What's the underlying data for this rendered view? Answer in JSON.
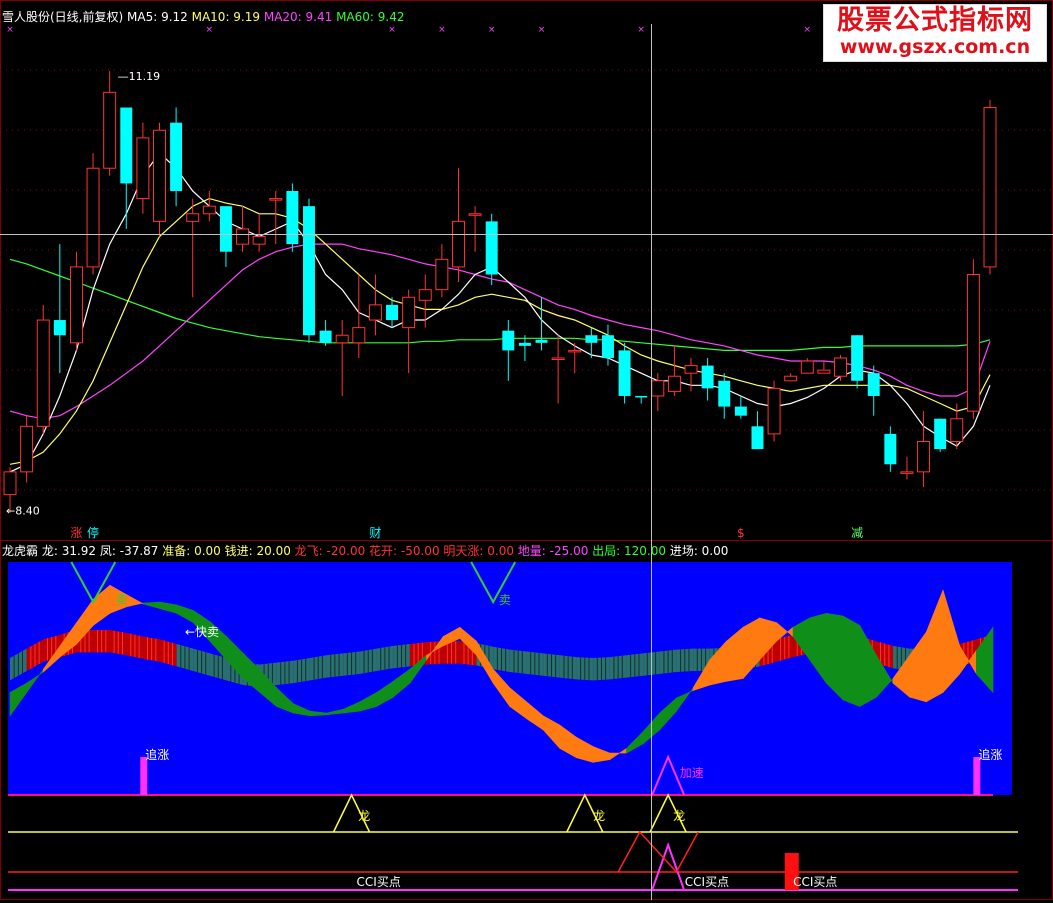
{
  "header": {
    "stock": "雪人股份(日线,前复权)",
    "ma": [
      {
        "label": "MA5: 9.12",
        "color": "#ffffff"
      },
      {
        "label": "MA10: 9.19",
        "color": "#ffff66"
      },
      {
        "label": "MA20: 9.41",
        "color": "#ff44ff"
      },
      {
        "label": "MA60: 9.42",
        "color": "#33ff33"
      }
    ]
  },
  "logo": {
    "name": "股票公式指标网",
    "url": "www.gszx.com.cn"
  },
  "colors": {
    "up": "#ff3333",
    "down": "#00ffff",
    "ma5": "#ffffff",
    "ma10": "#ffff66",
    "ma20": "#ff44ff",
    "ma60": "#33ff33",
    "panel_bg": "#0000ff",
    "orange": "#ff7a10",
    "green": "#0f8f1a",
    "crosshair": "#c0c0c0"
  },
  "chart_data": [
    {
      "type": "candlestick",
      "ylim": [
        8.2,
        11.5
      ],
      "high_label": "11.19",
      "low_label": "8.40",
      "candles": [
        [
          8.4,
          8.55,
          8.28,
          8.58
        ],
        [
          8.55,
          8.85,
          8.48,
          8.92
        ],
        [
          8.85,
          9.55,
          8.8,
          9.65
        ],
        [
          9.55,
          9.45,
          9.2,
          10.05
        ],
        [
          9.4,
          9.9,
          9.35,
          10.0
        ],
        [
          9.9,
          10.55,
          9.85,
          10.65
        ],
        [
          10.55,
          11.05,
          10.5,
          11.19
        ],
        [
          10.95,
          10.45,
          10.15,
          10.95
        ],
        [
          10.35,
          10.75,
          10.25,
          10.85
        ],
        [
          10.2,
          10.8,
          10.1,
          10.85
        ],
        [
          10.85,
          10.4,
          10.3,
          10.95
        ],
        [
          10.2,
          10.25,
          9.7,
          10.35
        ],
        [
          10.25,
          10.3,
          10.2,
          10.4
        ],
        [
          10.3,
          10.0,
          9.9,
          10.3
        ],
        [
          10.05,
          10.15,
          10.0,
          10.3
        ],
        [
          10.05,
          10.1,
          10.0,
          10.25
        ],
        [
          10.35,
          10.35,
          10.05,
          10.4
        ],
        [
          10.4,
          10.05,
          10.0,
          10.45
        ],
        [
          10.3,
          9.45,
          9.4,
          10.35
        ],
        [
          9.48,
          9.4,
          9.38,
          9.55
        ],
        [
          9.4,
          9.45,
          9.05,
          9.55
        ],
        [
          9.4,
          9.5,
          9.3,
          9.85
        ],
        [
          9.55,
          9.65,
          9.45,
          9.85
        ],
        [
          9.65,
          9.55,
          9.5,
          9.7
        ],
        [
          9.5,
          9.7,
          9.2,
          9.75
        ],
        [
          9.68,
          9.75,
          9.5,
          9.85
        ],
        [
          9.75,
          9.95,
          9.7,
          10.05
        ],
        [
          9.9,
          10.2,
          9.8,
          10.55
        ],
        [
          10.25,
          10.25,
          10.0,
          10.3
        ],
        [
          10.2,
          9.85,
          9.78,
          10.25
        ],
        [
          9.48,
          9.35,
          9.15,
          9.55
        ],
        [
          9.4,
          9.38,
          9.28,
          9.45
        ],
        [
          9.42,
          9.4,
          9.35,
          9.7
        ],
        [
          9.3,
          9.3,
          9.0,
          9.45
        ],
        [
          9.35,
          9.35,
          9.2,
          9.4
        ],
        [
          9.45,
          9.4,
          9.3,
          9.5
        ],
        [
          9.45,
          9.3,
          9.25,
          9.52
        ],
        [
          9.35,
          9.05,
          9.0,
          9.4
        ],
        [
          9.05,
          9.04,
          9.0,
          9.05
        ],
        [
          9.05,
          9.15,
          8.95,
          9.2
        ],
        [
          9.08,
          9.18,
          9.05,
          9.38
        ],
        [
          9.2,
          9.25,
          9.08,
          9.3
        ],
        [
          9.25,
          9.1,
          9.02,
          9.3
        ],
        [
          9.15,
          8.98,
          8.9,
          9.2
        ],
        [
          8.98,
          8.92,
          8.9,
          9.05
        ],
        [
          8.85,
          8.7,
          8.7,
          8.95
        ],
        [
          8.8,
          9.1,
          8.75,
          9.15
        ],
        [
          9.15,
          9.18,
          9.15,
          9.2
        ],
        [
          9.2,
          9.28,
          9.2,
          9.3
        ],
        [
          9.2,
          9.22,
          9.2,
          9.28
        ],
        [
          9.18,
          9.3,
          9.15,
          9.32
        ],
        [
          9.45,
          9.15,
          9.1,
          9.45
        ],
        [
          9.2,
          9.05,
          8.92,
          9.25
        ],
        [
          8.8,
          8.6,
          8.55,
          8.85
        ],
        [
          8.55,
          8.55,
          8.5,
          8.65
        ],
        [
          8.55,
          8.75,
          8.45,
          8.95
        ],
        [
          8.9,
          8.7,
          8.68,
          8.9
        ],
        [
          8.75,
          8.9,
          8.7,
          9.0
        ],
        [
          8.95,
          9.85,
          8.9,
          9.95
        ],
        [
          9.9,
          10.95,
          9.85,
          11.0
        ]
      ],
      "ma5": [
        8.55,
        8.6,
        8.8,
        9.05,
        9.35,
        9.75,
        10.05,
        10.25,
        10.5,
        10.65,
        10.55,
        10.4,
        10.3,
        10.2,
        10.15,
        10.1,
        10.15,
        10.2,
        10.05,
        9.85,
        9.75,
        9.6,
        9.55,
        9.5,
        9.55,
        9.55,
        9.62,
        9.72,
        9.85,
        9.9,
        9.8,
        9.7,
        9.55,
        9.45,
        9.38,
        9.32,
        9.3,
        9.25,
        9.2,
        9.15,
        9.15,
        9.12,
        9.12,
        9.1,
        9.05,
        9.0,
        8.98,
        9.0,
        9.04,
        9.1,
        9.18,
        9.22,
        9.2,
        9.12,
        9.0,
        8.85,
        8.78,
        8.72,
        8.85,
        9.12
      ],
      "ma10": [
        8.6,
        8.62,
        8.68,
        8.8,
        8.95,
        9.15,
        9.4,
        9.65,
        9.9,
        10.1,
        10.2,
        10.3,
        10.35,
        10.32,
        10.3,
        10.25,
        10.25,
        10.22,
        10.15,
        10.05,
        9.95,
        9.85,
        9.75,
        9.68,
        9.65,
        9.62,
        9.62,
        9.65,
        9.7,
        9.72,
        9.7,
        9.68,
        9.62,
        9.58,
        9.55,
        9.5,
        9.45,
        9.38,
        9.32,
        9.28,
        9.25,
        9.22,
        9.2,
        9.18,
        9.15,
        9.12,
        9.1,
        9.08,
        9.1,
        9.12,
        9.12,
        9.12,
        9.12,
        9.12,
        9.1,
        9.05,
        9.0,
        8.95,
        8.98,
        9.19
      ],
      "ma20": [
        8.95,
        8.92,
        8.9,
        8.92,
        8.98,
        9.05,
        9.12,
        9.2,
        9.28,
        9.38,
        9.48,
        9.58,
        9.68,
        9.78,
        9.88,
        9.95,
        10.0,
        10.03,
        10.05,
        10.05,
        10.05,
        10.02,
        10.0,
        9.98,
        9.95,
        9.92,
        9.9,
        9.88,
        9.85,
        9.82,
        9.8,
        9.75,
        9.7,
        9.65,
        9.62,
        9.58,
        9.55,
        9.52,
        9.5,
        9.48,
        9.45,
        9.42,
        9.4,
        9.38,
        9.35,
        9.32,
        9.3,
        9.28,
        9.28,
        9.28,
        9.27,
        9.25,
        9.22,
        9.18,
        9.12,
        9.08,
        9.05,
        9.05,
        9.1,
        9.41
      ],
      "ma60": [
        9.95,
        9.92,
        9.88,
        9.84,
        9.8,
        9.76,
        9.72,
        9.68,
        9.64,
        9.6,
        9.56,
        9.53,
        9.5,
        9.48,
        9.46,
        9.44,
        9.43,
        9.42,
        9.41,
        9.4,
        9.4,
        9.4,
        9.4,
        9.4,
        9.4,
        9.41,
        9.41,
        9.42,
        9.42,
        9.42,
        9.43,
        9.43,
        9.43,
        9.43,
        9.43,
        9.42,
        9.42,
        9.41,
        9.4,
        9.39,
        9.38,
        9.37,
        9.36,
        9.35,
        9.35,
        9.35,
        9.35,
        9.35,
        9.36,
        9.37,
        9.37,
        9.38,
        9.38,
        9.38,
        9.38,
        9.38,
        9.38,
        9.38,
        9.39,
        9.42
      ],
      "markers": [
        {
          "i": 4,
          "text": "涨",
          "color": "#ff3333"
        },
        {
          "i": 5,
          "text": "停",
          "color": "#00ffff"
        },
        {
          "i": 22,
          "text": "财",
          "color": "#00ffff"
        },
        {
          "i": 44,
          "text": "$",
          "color": "#ff3333"
        },
        {
          "i": 51,
          "text": "减",
          "color": "#66ff66"
        }
      ],
      "top_marks": [
        0,
        12,
        23,
        26,
        29,
        32,
        38,
        48
      ]
    },
    {
      "type": "indicator",
      "title": "龙虎霸",
      "values": [
        {
          "label": "龙: 31.92",
          "color": "#ffffff"
        },
        {
          "label": "凤: -37.87",
          "color": "#ffffff"
        },
        {
          "label": "准备: 0.00",
          "color": "#ffff66"
        },
        {
          "label": "钱进: 20.00",
          "color": "#ffff66"
        },
        {
          "label": "龙飞: -20.00",
          "color": "#ff3333"
        },
        {
          "label": "花开: -50.00",
          "color": "#ff3333"
        },
        {
          "label": "明天涨: 0.00",
          "color": "#ff3333"
        },
        {
          "label": "地量: -25.00",
          "color": "#ff44ff"
        },
        {
          "label": "出局: 120.00",
          "color": "#33ff33"
        },
        {
          "label": "进场: 0.00",
          "color": "#ffffff"
        }
      ],
      "ylim": [
        -140,
        110
      ],
      "long": [
        -30,
        -20,
        -8,
        8,
        22,
        42,
        55,
        62,
        66,
        67,
        64,
        58,
        46,
        30,
        12,
        -6,
        -25,
        -42,
        -50,
        -52,
        -48,
        -40,
        -30,
        -18,
        -5,
        10,
        20,
        28,
        10,
        -20,
        -45,
        -58,
        -70,
        -90,
        -100,
        -105,
        -102,
        -90,
        -72,
        -52,
        -36,
        -28,
        -22,
        -18,
        -15,
        5,
        25,
        40,
        50,
        55,
        52,
        42,
        10,
        -20,
        -35,
        -40,
        -30,
        -10,
        15,
        40
      ],
      "short": [
        -55,
        -30,
        -5,
        20,
        45,
        70,
        85,
        75,
        65,
        60,
        55,
        45,
        25,
        5,
        -15,
        -30,
        -45,
        -52,
        -55,
        -54,
        -52,
        -50,
        -45,
        -35,
        -20,
        5,
        30,
        40,
        25,
        -5,
        -25,
        -40,
        -55,
        -65,
        -78,
        -88,
        -95,
        -95,
        -85,
        -70,
        -50,
        -25,
        5,
        25,
        40,
        50,
        45,
        30,
        5,
        -20,
        -38,
        -45,
        -35,
        -15,
        10,
        35,
        80,
        20,
        -10,
        -30
      ],
      "base": [
        -15,
        -5,
        5,
        10,
        15,
        15,
        15,
        12,
        8,
        5,
        0,
        -5,
        -10,
        -15,
        -20,
        -22,
        -20,
        -18,
        -15,
        -12,
        -10,
        -8,
        -5,
        -2,
        0,
        2,
        3,
        3,
        1,
        -3,
        -6,
        -8,
        -10,
        -12,
        -14,
        -15,
        -14,
        -12,
        -10,
        -8,
        -6,
        -5,
        -5,
        -4,
        -3,
        0,
        5,
        10,
        14,
        15,
        12,
        8,
        3,
        -2,
        -5,
        -5,
        -3,
        0,
        5,
        10
      ],
      "signals": [
        {
          "i": 3,
          "text": "快卖"
        },
        {
          "i": 8,
          "text": "追涨"
        },
        {
          "i": 58,
          "text": "追涨"
        },
        {
          "i": 38,
          "text": "加速"
        },
        {
          "i": 21,
          "text": "龙"
        },
        {
          "i": 35,
          "text": "龙"
        },
        {
          "i": 40,
          "text": "龙"
        },
        {
          "i": 6,
          "text": "卖"
        },
        {
          "i": 29,
          "text": "卖"
        },
        {
          "i": 22,
          "text": "CCI买点"
        },
        {
          "i": 42,
          "text": "CCI买点"
        },
        {
          "i": 48,
          "text": "CCI买点"
        }
      ]
    }
  ]
}
